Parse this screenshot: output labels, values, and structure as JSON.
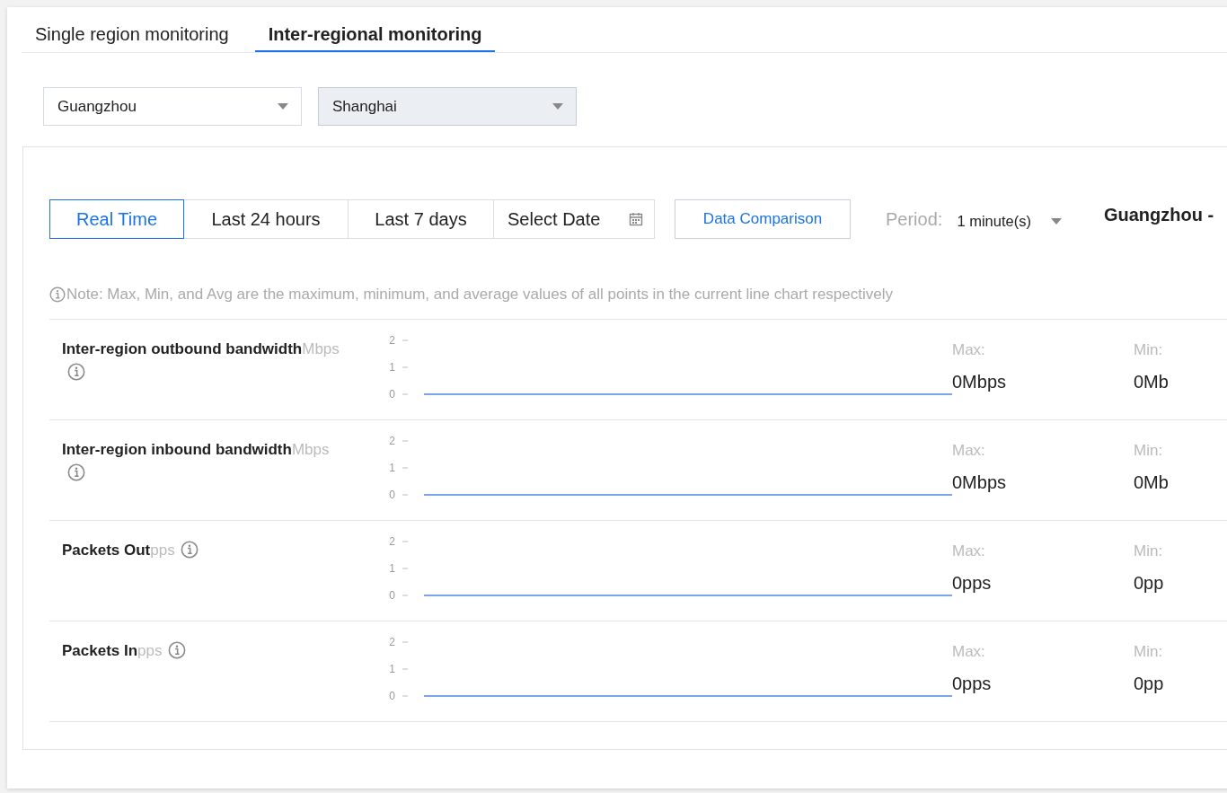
{
  "tabs": [
    {
      "label": "Single region monitoring",
      "selected": false
    },
    {
      "label": "Inter-regional monitoring",
      "selected": true
    }
  ],
  "regions": [
    {
      "value": "Guangzhou",
      "focused": false
    },
    {
      "value": "Shanghai",
      "focused": true
    }
  ],
  "time_ranges": [
    {
      "label": "Real Time",
      "selected": true,
      "kind": "button"
    },
    {
      "label": "Last 24 hours",
      "selected": false,
      "kind": "button"
    },
    {
      "label": "Last 7 days",
      "selected": false,
      "kind": "button"
    },
    {
      "label": "Select Date",
      "selected": false,
      "kind": "date"
    }
  ],
  "compare_button": "Data Comparison",
  "period": {
    "label": "Period:",
    "value": "1 minute(s)"
  },
  "route_title": "Guangzhou -",
  "note": "Note: Max, Min, and Avg are the maximum, minimum, and average values of all points in the current line chart respectively",
  "metrics": [
    {
      "label": "**Inter-region outbound bandwidth**Mbps",
      "max_label": "Max:",
      "max": "0Mbps",
      "min_label": "Min:",
      "min": "0Mb",
      "chart_data": {
        "type": "line",
        "ylim": [
          0,
          2
        ],
        "yticks": [
          0,
          1,
          2
        ],
        "series": [
          {
            "color": "#7aa5e8",
            "values": [
              0,
              0,
              0,
              0,
              0,
              0,
              0,
              0,
              0,
              0,
              0,
              0,
              0,
              0,
              0,
              0,
              0,
              0,
              0,
              0,
              0,
              0,
              0,
              0,
              0,
              0,
              0,
              0,
              0,
              0
            ]
          }
        ]
      }
    },
    {
      "label": "**Inter-region inbound bandwidth**Mbps",
      "max_label": "Max:",
      "max": "0Mbps",
      "min_label": "Min:",
      "min": "0Mb",
      "chart_data": {
        "type": "line",
        "ylim": [
          0,
          2
        ],
        "yticks": [
          0,
          1,
          2
        ],
        "series": [
          {
            "color": "#7aa5e8",
            "values": [
              0,
              0,
              0,
              0,
              0,
              0,
              0,
              0,
              0,
              0,
              0,
              0,
              0,
              0,
              0,
              0,
              0,
              0,
              0,
              0,
              0,
              0,
              0,
              0,
              0,
              0,
              0,
              0,
              0,
              0
            ]
          }
        ]
      }
    },
    {
      "label": "**Packets Out**pps",
      "max_label": "Max:",
      "max": "0pps",
      "min_label": "Min:",
      "min": "0pp",
      "chart_data": {
        "type": "line",
        "ylim": [
          0,
          2
        ],
        "yticks": [
          0,
          1,
          2
        ],
        "series": [
          {
            "color": "#7aa5e8",
            "values": [
              0,
              0,
              0,
              0,
              0,
              0,
              0,
              0,
              0,
              0,
              0,
              0,
              0,
              0,
              0,
              0,
              0,
              0,
              0,
              0,
              0,
              0,
              0,
              0,
              0,
              0,
              0,
              0,
              0,
              0
            ]
          }
        ]
      }
    },
    {
      "label": "**Packets In**pps",
      "max_label": "Max:",
      "max": "0pps",
      "min_label": "Min:",
      "min": "0pp",
      "chart_data": {
        "type": "line",
        "ylim": [
          0,
          2
        ],
        "yticks": [
          0,
          1,
          2
        ],
        "series": [
          {
            "color": "#7aa5e8",
            "values": [
              0,
              0,
              0,
              0,
              0,
              0,
              0,
              0,
              0,
              0,
              0,
              0,
              0,
              0,
              0,
              0,
              0,
              0,
              0,
              0,
              0,
              0,
              0,
              0,
              0,
              0,
              0,
              0,
              0,
              0
            ]
          }
        ]
      }
    }
  ]
}
